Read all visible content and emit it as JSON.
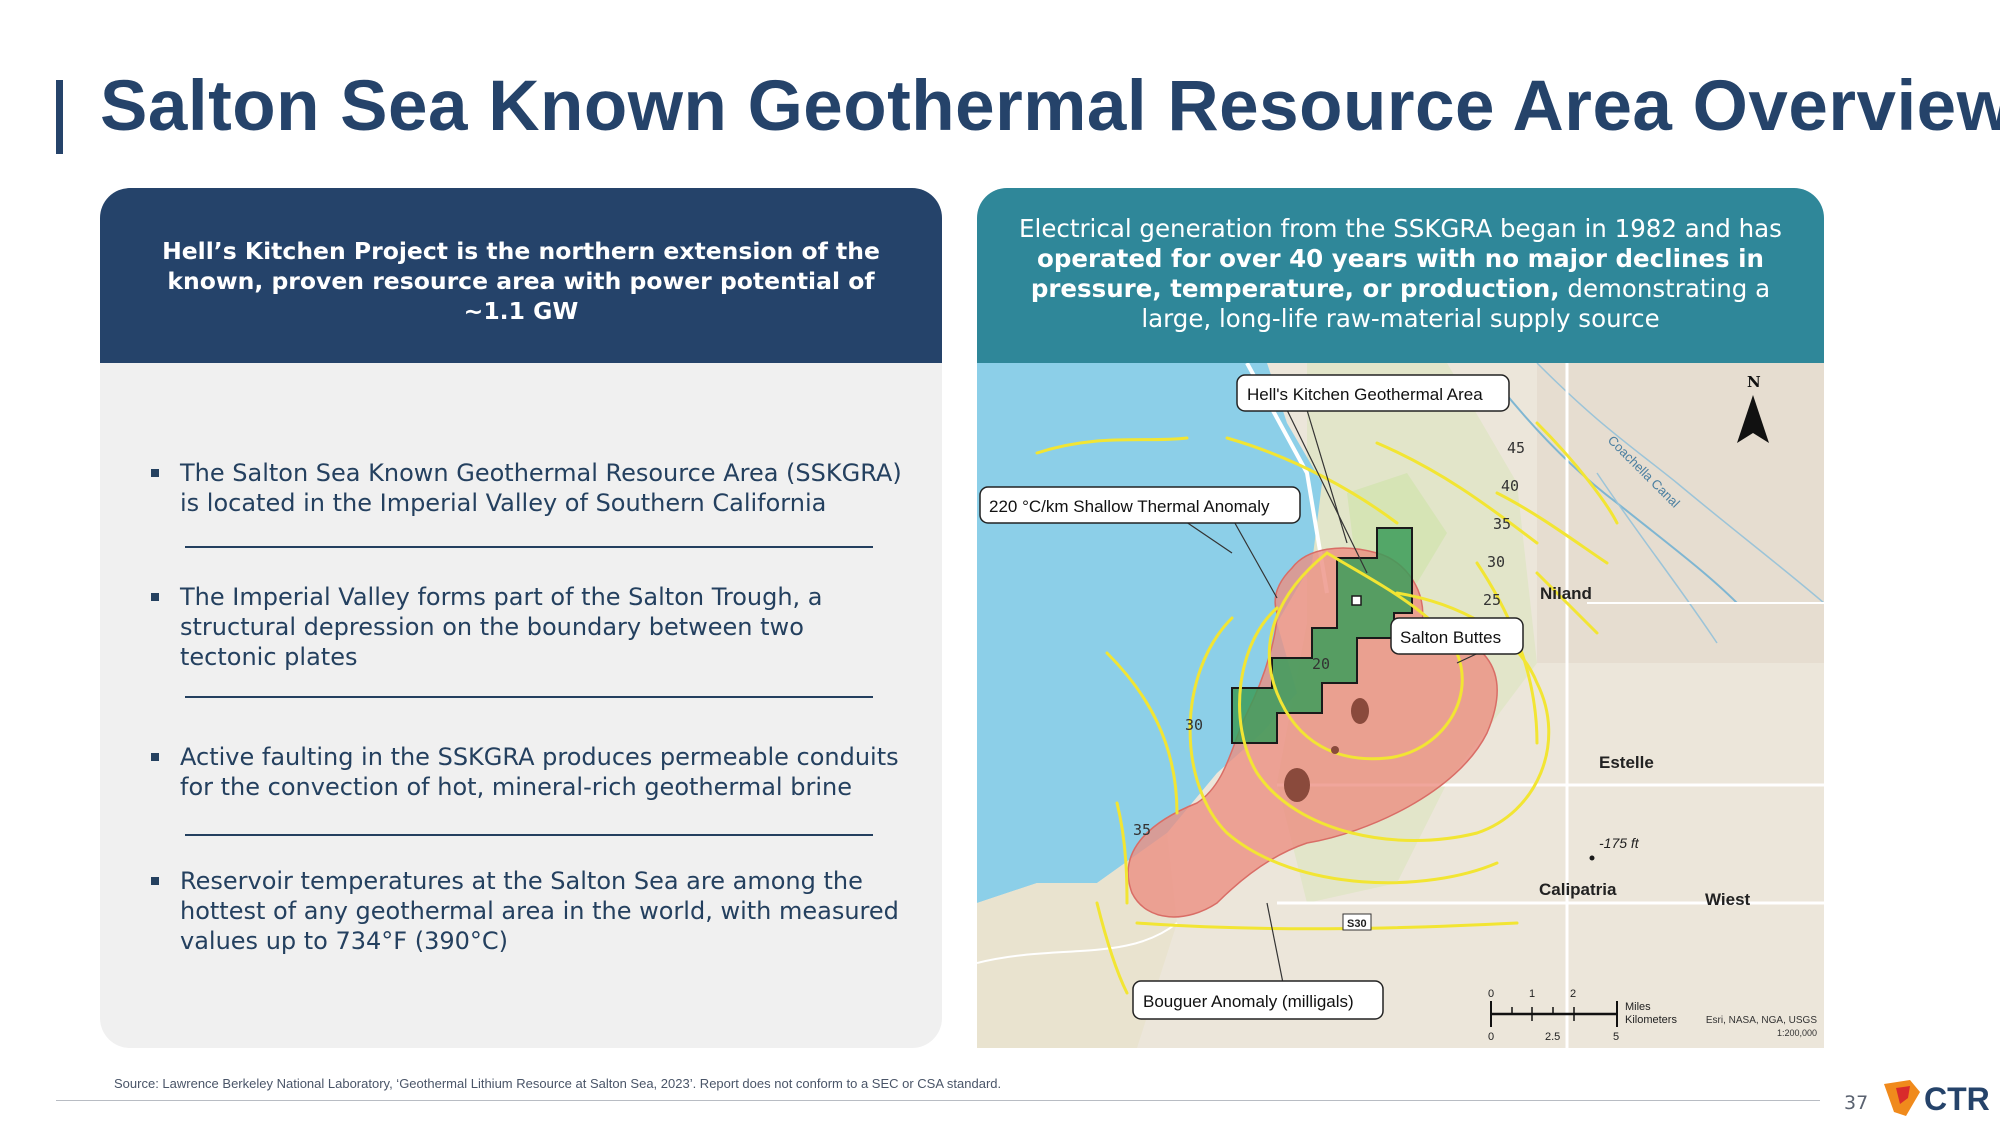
{
  "title": "Salton Sea Known Geothermal Resource Area Overview",
  "left_panel": {
    "header": "Hell’s Kitchen Project is the northern extension of the known, proven resource area with power potential of ~1.1 GW",
    "bullets": [
      "The Salton Sea Known Geothermal Resource Area (SSKGRA) is located in the Imperial Valley of Southern California",
      "The Imperial Valley forms part of the Salton Trough, a structural depression on the boundary between two tectonic plates",
      "Active faulting in the SSKGRA produces permeable conduits for the convection of hot, mineral-rich geothermal brine",
      "Reservoir temperatures at the Salton Sea are among the hottest of any geothermal area in the world, with measured values up to 734°F (390°C)"
    ]
  },
  "right_panel": {
    "header_part1": "Electrical generation from the SSKGRA began in 1982 and has",
    "header_bold": "operated for over 40 years with no major declines in pressure, temperature, or production,",
    "header_part2": "demonstrating a large, long-life raw-material supply source",
    "map": {
      "callouts": {
        "hells_kitchen": "Hell's Kitchen Geothermal Area",
        "thermal_anomaly": "220 °C/km Shallow Thermal Anomaly",
        "salton_buttes": "Salton Buttes",
        "bouguer": "Bouguer Anomaly (milligals)"
      },
      "places": {
        "niland": "Niland",
        "estelle": "Estelle",
        "calipatria": "Calipatria",
        "wiest": "Wiest",
        "canal": "Coachella Canal",
        "elevation": "-175 ft",
        "road": "S30"
      },
      "contours": [
        "45",
        "40",
        "35",
        "30",
        "25",
        "20",
        "30",
        "35"
      ],
      "north": "N",
      "scale": {
        "miles_ticks": [
          "0",
          "1",
          "2"
        ],
        "km_ticks": [
          "0",
          "2.5",
          "5"
        ],
        "miles_label": "Miles",
        "km_label": "Kilometers"
      },
      "attribution": "Esri, NASA, NGA, USGS",
      "ratio": "1:200,000"
    }
  },
  "footer": {
    "source": "Source: Lawrence Berkeley National Laboratory, ‘Geothermal Lithium Resource at Salton Sea, 2023’. Report does not conform to a SEC or CSA standard.",
    "page": "37",
    "logo_text": "CTR"
  },
  "colors": {
    "navy": "#25436a",
    "teal": "#2f8799",
    "lake": "#8ccfe8",
    "anomaly": "#ec8d80",
    "project": "#3c9c5a",
    "contour": "#f2e533"
  }
}
